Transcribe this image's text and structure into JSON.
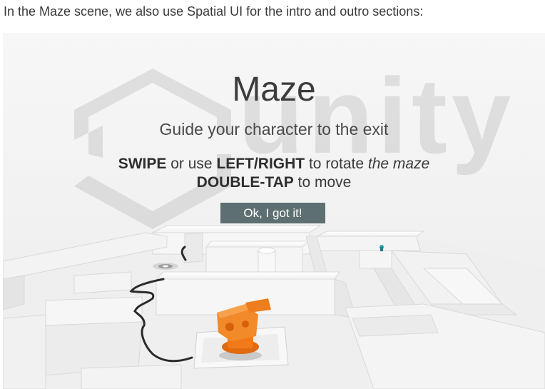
{
  "caption": "In the Maze scene, we also use Spatial UI for the intro and outro sections:",
  "background_logo": "unity",
  "dialog": {
    "title": "Maze",
    "subtitle": "Guide your character to the exit",
    "line1": {
      "swipe": "SWIPE",
      "or_use": "or use",
      "left_right": "LEFT/RIGHT",
      "to_rotate": "to rotate",
      "the_maze": "the maze"
    },
    "line2": {
      "double_tap": "DOUBLE-TAP",
      "to_move": "to move"
    },
    "button_label": "Ok, I got it!"
  },
  "colors": {
    "button": "#5e6f71",
    "character": "#f07a1a",
    "maze": "#f3f3f3"
  }
}
